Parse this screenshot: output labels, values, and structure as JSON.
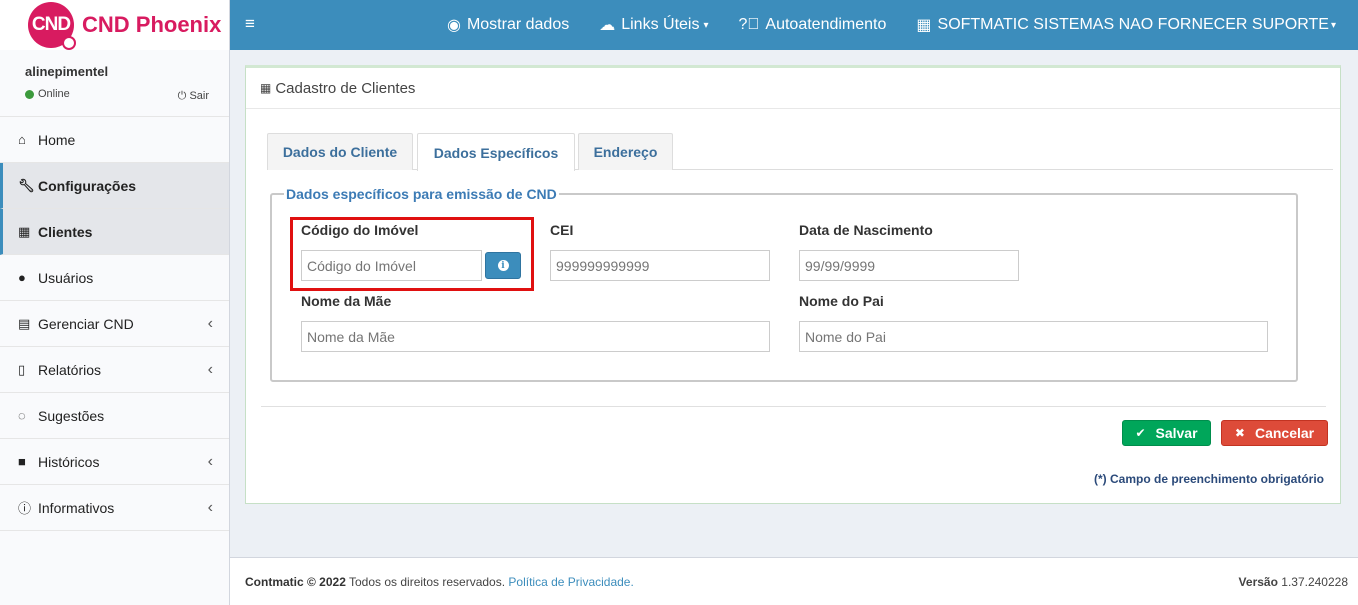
{
  "brand": {
    "logo_initials": "CND",
    "name": "CND Phoenix"
  },
  "user": {
    "name": "alinepimentel",
    "status": "Online",
    "logout_label": "Sair"
  },
  "sidebar": {
    "items": [
      {
        "label": "Home",
        "icon": "home-icon"
      },
      {
        "label": "Configurações",
        "icon": "wrench-icon"
      },
      {
        "label": "Clientes",
        "icon": "building-icon"
      },
      {
        "label": "Usuários",
        "icon": "user-icon"
      },
      {
        "label": "Gerenciar CND",
        "icon": "calendar-icon"
      },
      {
        "label": "Relatórios",
        "icon": "file-icon"
      },
      {
        "label": "Sugestões",
        "icon": "comments-icon"
      },
      {
        "label": "Históricos",
        "icon": "archive-icon"
      },
      {
        "label": "Informativos",
        "icon": "info-circle-icon"
      }
    ]
  },
  "topbar": {
    "show_data": "Mostrar dados",
    "links": "Links Úteis",
    "self_service": "Autoatendimento",
    "company": "SOFTMATIC SISTEMAS NAO FORNECER SUPORTE"
  },
  "page": {
    "title": "Cadastro de Clientes"
  },
  "tabs": [
    "Dados do Cliente",
    "Dados Específicos",
    "Endereço"
  ],
  "form": {
    "legend": "Dados específicos para emissão de CND",
    "codigo_label": "Código do Imóvel",
    "codigo_placeholder": "Código do Imóvel",
    "cei_label": "CEI",
    "cei_placeholder": "999999999999",
    "nascimento_label": "Data de Nascimento",
    "nascimento_placeholder": "99/99/9999",
    "mae_label": "Nome da Mãe",
    "mae_placeholder": "Nome da Mãe",
    "pai_label": "Nome do Pai",
    "pai_placeholder": "Nome do Pai"
  },
  "actions": {
    "save": "Salvar",
    "cancel": "Cancelar"
  },
  "note": "(*) Campo de preenchimento obrigatório",
  "footer": {
    "brand": "Contmatic © 2022",
    "rights": " Todos os direitos reservados. ",
    "privacy": "Política de Privacidade.",
    "version_label": "Versão",
    "version": "1.37.240228"
  },
  "colors": {
    "brand": "#d81b60",
    "primary": "#3c8dbc",
    "success": "#00a65a",
    "danger": "#dd4b39",
    "highlight": "#e01010"
  }
}
